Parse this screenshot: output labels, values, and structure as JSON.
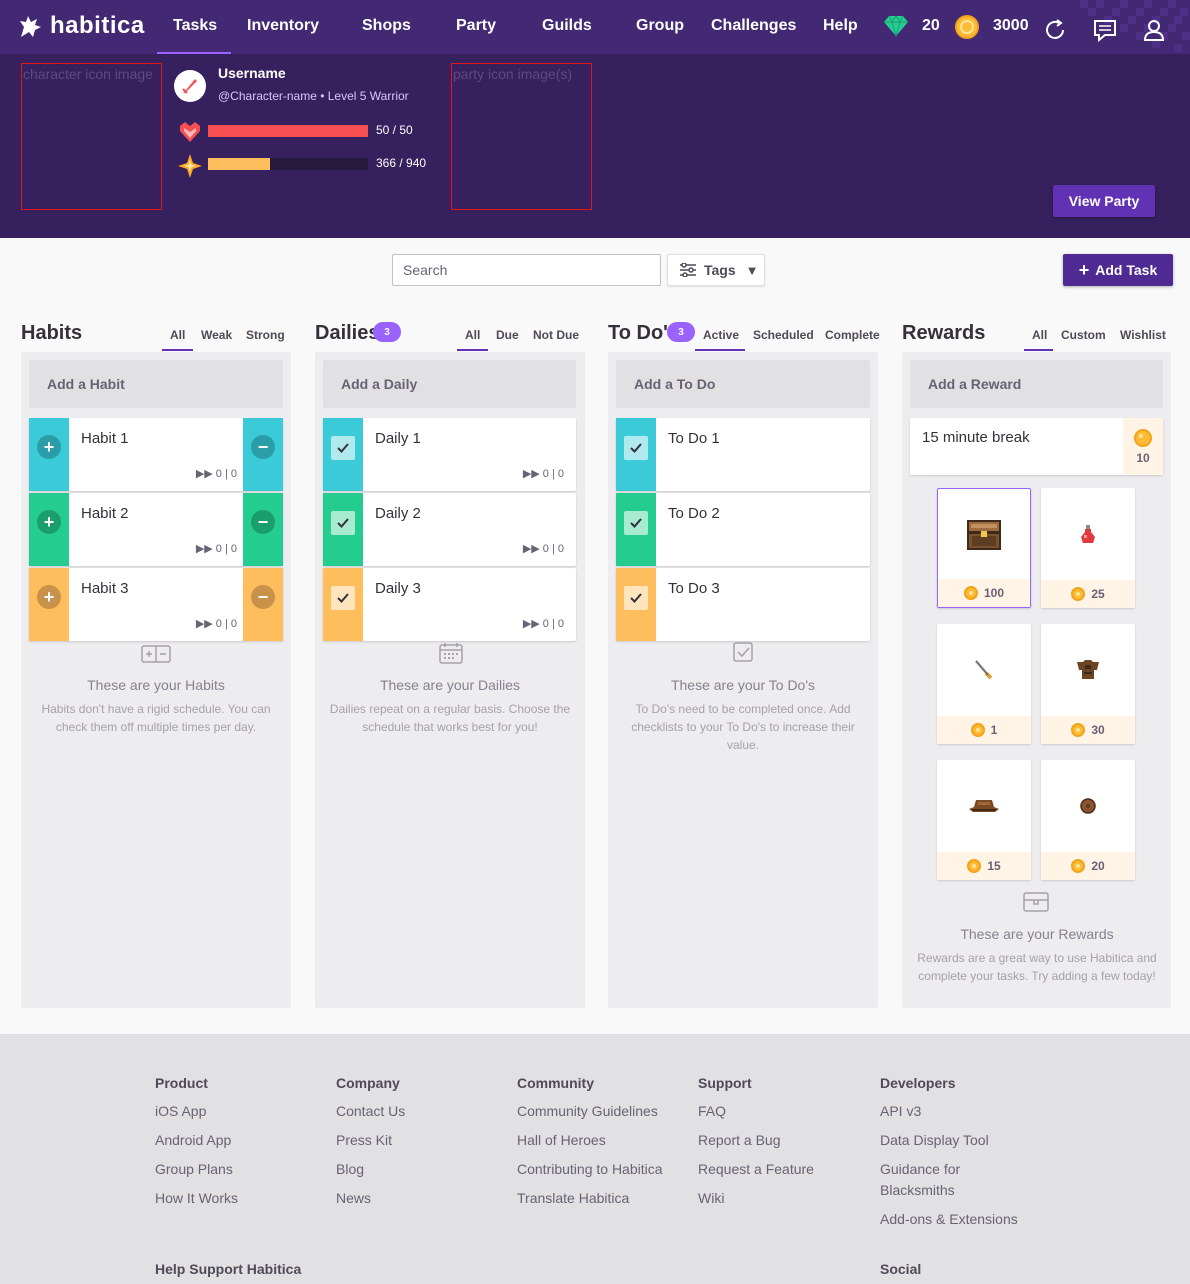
{
  "nav": {
    "logo": "habitica",
    "items": [
      "Tasks",
      "Inventory",
      "Shops",
      "Party",
      "Guilds",
      "Group",
      "Challenges",
      "Help"
    ],
    "gems": "20",
    "gold": "3000"
  },
  "header": {
    "character_placeholder": "character icon image",
    "party_placeholder": "party icon image(s)",
    "username": "Username",
    "userinfo": "@Character-name • Level 5 Warrior",
    "hp_text": "50 / 50",
    "hp_fraction": 1.0,
    "xp_text": "366 / 940",
    "xp_fraction": 0.389,
    "view_party": "View Party"
  },
  "toolbar": {
    "search_placeholder": "Search",
    "tags": "Tags",
    "add_task": "Add Task"
  },
  "habits": {
    "title": "Habits",
    "filters": [
      "All",
      "Weak",
      "Strong"
    ],
    "add": "Add a Habit",
    "items": [
      {
        "name": "Habit 1",
        "meta": "▶▶ 0 | 0"
      },
      {
        "name": "Habit 2",
        "meta": "▶▶ 0 | 0"
      },
      {
        "name": "Habit 3",
        "meta": "▶▶ 0 | 0"
      }
    ],
    "empty_title": "These are your Habits",
    "empty_text": "Habits don't have a rigid schedule. You can check them off multiple times per day."
  },
  "dailies": {
    "title": "Dailies",
    "badge": "3",
    "filters": [
      "All",
      "Due",
      "Not Due"
    ],
    "add": "Add a Daily",
    "items": [
      {
        "name": "Daily 1",
        "meta": "▶▶ 0 | 0"
      },
      {
        "name": "Daily 2",
        "meta": "▶▶ 0 | 0"
      },
      {
        "name": "Daily 3",
        "meta": "▶▶ 0 | 0"
      }
    ],
    "empty_title": "These are your Dailies",
    "empty_text": "Dailies repeat on a regular basis. Choose the schedule that works best for you!"
  },
  "todos": {
    "title": "To Do's",
    "badge": "3",
    "filters": [
      "Active",
      "Scheduled",
      "Complete"
    ],
    "add": "Add a To Do",
    "items": [
      {
        "name": "To Do 1"
      },
      {
        "name": "To Do 2"
      },
      {
        "name": "To Do 3"
      }
    ],
    "empty_title": "These are your To Do's",
    "empty_text": "To Do's need to be completed once. Add checklists to your To Do's to increase their value."
  },
  "rewards": {
    "title": "Rewards",
    "filters": [
      "All",
      "Custom",
      "Wishlist"
    ],
    "add": "Add a Reward",
    "custom": {
      "name": "15 minute break",
      "price": "10"
    },
    "shop": [
      "100",
      "25",
      "1",
      "30",
      "15",
      "20"
    ],
    "empty_title": "These are your Rewards",
    "empty_text": "Rewards are a great way to use Habitica and complete your tasks. Try adding a few today!"
  },
  "footer": {
    "product": {
      "head": "Product",
      "links": [
        "iOS App",
        "Android App",
        "Group Plans",
        "How It Works"
      ]
    },
    "company": {
      "head": "Company",
      "links": [
        "Contact Us",
        "Press Kit",
        "Blog",
        "News"
      ]
    },
    "community": {
      "head": "Community",
      "links": [
        "Community Guidelines",
        "Hall of Heroes",
        "Contributing to Habitica",
        "Translate Habitica"
      ]
    },
    "support": {
      "head": "Support",
      "links": [
        "FAQ",
        "Report a Bug",
        "Request a Feature",
        "Wiki"
      ]
    },
    "developers": {
      "head": "Developers",
      "links": [
        "API v3",
        "Data Display Tool",
        "Guidance for Blacksmiths",
        "Add-ons & Extensions"
      ]
    },
    "help_support": "Help Support Habitica",
    "social": "Social"
  },
  "colors": {
    "nav": "#432874",
    "header": "#36205d",
    "teal": "#3bcad7",
    "green": "#24cc8f",
    "yellow": "#ffbe5d",
    "hp": "#f74e52",
    "xp": "#ffbe5d",
    "accent": "#6133b4"
  }
}
